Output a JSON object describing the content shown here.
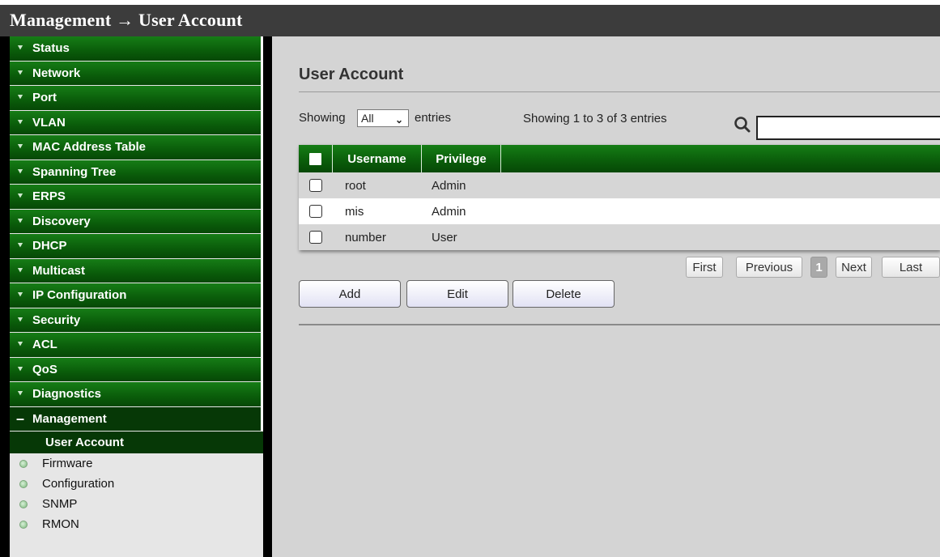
{
  "header": {
    "title": "Management → User Account"
  },
  "sidebar": {
    "items": [
      {
        "label": "Status"
      },
      {
        "label": "Network"
      },
      {
        "label": "Port"
      },
      {
        "label": "VLAN"
      },
      {
        "label": "MAC Address Table"
      },
      {
        "label": "Spanning Tree"
      },
      {
        "label": "ERPS"
      },
      {
        "label": "Discovery"
      },
      {
        "label": "DHCP"
      },
      {
        "label": "Multicast"
      },
      {
        "label": "IP Configuration"
      },
      {
        "label": "Security"
      },
      {
        "label": "ACL"
      },
      {
        "label": "QoS"
      },
      {
        "label": "Diagnostics"
      }
    ],
    "open_item": {
      "label": "Management"
    },
    "sub_items": [
      {
        "label": "User Account",
        "active": true
      },
      {
        "label": "Firmware"
      },
      {
        "label": "Configuration"
      },
      {
        "label": "SNMP"
      },
      {
        "label": "RMON"
      }
    ],
    "collapsed_icon": "double-chevron-down-icon",
    "expanded_icon": "minus-icon",
    "sub_icon": "green-dot-icon"
  },
  "main": {
    "title": "User Account",
    "showing_label": "Showing",
    "page_size": "All",
    "entries_label": "entries",
    "summary": "Showing 1 to 3 of 3 entries",
    "search_value": "",
    "table": {
      "columns": [
        "Username",
        "Privilege"
      ],
      "rows": [
        {
          "username": "root",
          "privilege": "Admin"
        },
        {
          "username": "mis",
          "privilege": "Admin"
        },
        {
          "username": "number",
          "privilege": "User"
        }
      ]
    },
    "pagination": {
      "first": "First",
      "previous": "Previous",
      "current": "1",
      "next": "Next",
      "last": "Last"
    },
    "buttons": {
      "add": "Add",
      "edit": "Edit",
      "delete": "Delete"
    }
  },
  "colors": {
    "menu_green": "#0a5c0a",
    "title_bar": "#3c3c3c",
    "page_background": "#d4d4d4"
  }
}
